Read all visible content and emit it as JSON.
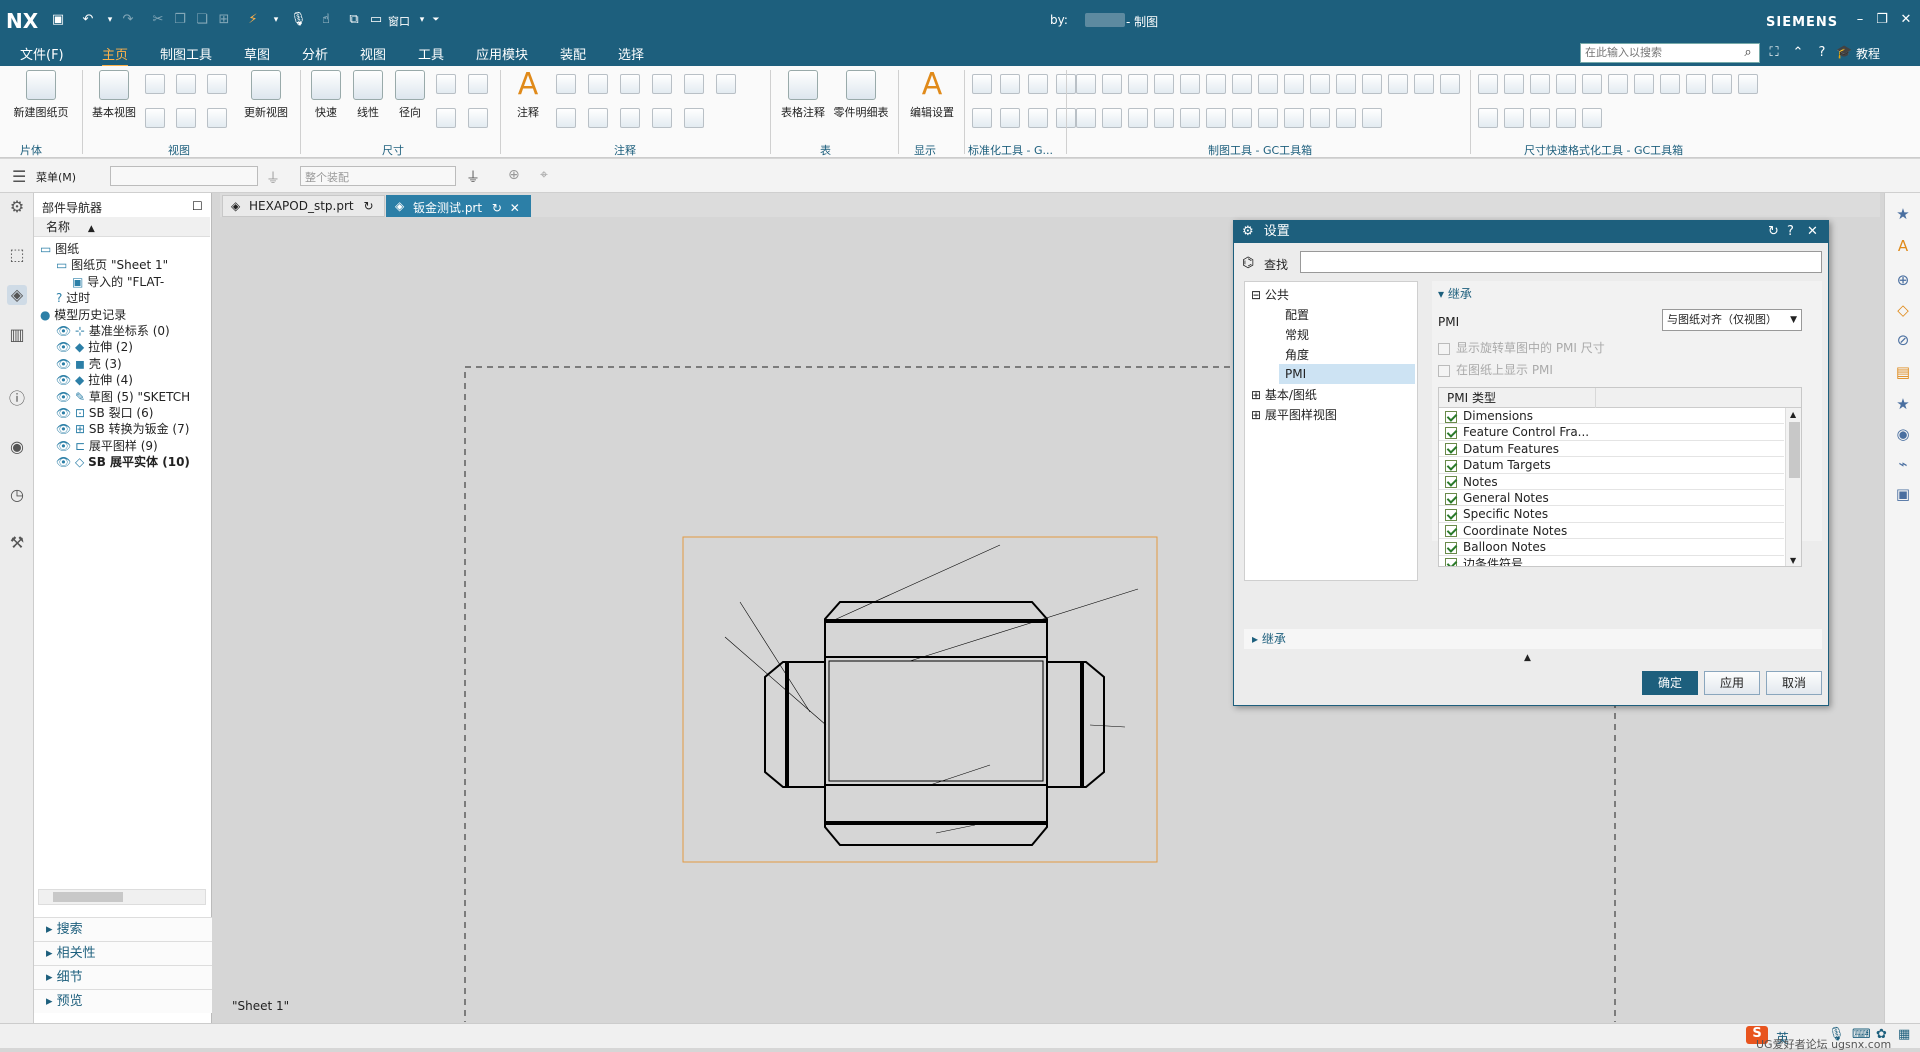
{
  "app": {
    "logo": "NX",
    "title_by": "by:",
    "window_title": "- 制图",
    "brand": "SIEMENS",
    "window_menu": "窗口",
    "help_label": "教程"
  },
  "menu": [
    "文件(F)",
    "主页",
    "制图工具",
    "草图",
    "分析",
    "视图",
    "工具",
    "应用模块",
    "装配",
    "选择"
  ],
  "search": {
    "placeholder": "在此输入以搜索"
  },
  "ribbon": {
    "buttons": {
      "new_sheet": "新建图纸页",
      "base_view": "基本视图",
      "update_view": "更新视图",
      "quick": "快速",
      "linear": "线性",
      "radial": "径向",
      "note": "注释",
      "table_note": "表格注释",
      "parts_list": "零件明细表",
      "edit_settings": "编辑设置"
    },
    "groups": {
      "sheet": "片体",
      "view": "视图",
      "dimension": "尺寸",
      "annotation": "注释",
      "table": "表",
      "display": "显示",
      "std_tools": "标准化工具 - G...",
      "draft_tools": "制图工具 - GC工具箱",
      "dim_format": "尺寸快速格式化工具 - GC工具箱"
    }
  },
  "toolbar2": {
    "menu_label": "菜单(M)",
    "filter_placeholder": "",
    "assembly_combo": "整个装配"
  },
  "nav": {
    "title": "部件导航器",
    "column": "名称",
    "tree": [
      {
        "label": "图纸",
        "indent": 0,
        "icon": "drawing-icon"
      },
      {
        "label": "图纸页 \"Sheet 1\"",
        "indent": 1,
        "icon": "sheet-icon"
      },
      {
        "label": "导入的 \"FLAT-",
        "indent": 2,
        "icon": "view-icon"
      },
      {
        "label": "过时",
        "indent": 1,
        "icon": "outdated-icon"
      },
      {
        "label": "模型历史记录",
        "indent": 0,
        "icon": "history-icon"
      },
      {
        "label": "基准坐标系 (0)",
        "indent": 1,
        "icon": "csys-icon"
      },
      {
        "label": "拉伸 (2)",
        "indent": 1,
        "icon": "extrude-icon"
      },
      {
        "label": "壳 (3)",
        "indent": 1,
        "icon": "shell-icon"
      },
      {
        "label": "拉伸 (4)",
        "indent": 1,
        "icon": "extrude-icon"
      },
      {
        "label": "草图 (5) \"SKETCH",
        "indent": 1,
        "icon": "sketch-icon"
      },
      {
        "label": "SB 裂口 (6)",
        "indent": 1,
        "icon": "rip-icon"
      },
      {
        "label": "SB 转换为钣金 (7)",
        "indent": 1,
        "icon": "convert-icon"
      },
      {
        "label": "展平图样 (9)",
        "indent": 1,
        "icon": "flat-pattern-icon"
      },
      {
        "label": "SB 展平实体 (10)",
        "indent": 1,
        "icon": "flat-solid-icon",
        "bold": true
      }
    ],
    "accordion": [
      "搜索",
      "相关性",
      "细节",
      "预览"
    ]
  },
  "tabs": [
    {
      "label": "HEXAPOD_stp.prt"
    },
    {
      "label": "钣金测试.prt"
    }
  ],
  "canvas": {
    "sheet_label": "\"Sheet 1\""
  },
  "dialog": {
    "title": "设置",
    "find_label": "查找",
    "find_value": "",
    "tree": {
      "common": "公共",
      "items": [
        "配置",
        "常规",
        "角度",
        "PMI"
      ],
      "basic": "基本/图纸",
      "flat": "展平图样视图"
    },
    "section_title": "继承",
    "pmi_label": "PMI",
    "pmi_select": "与图纸对齐（仅视图）",
    "opt_rotate": "显示旋转草图中的 PMI 尺寸",
    "opt_show": "在图纸上显示 PMI",
    "pmi_header": "PMI 类型",
    "pmi_types": [
      "Dimensions",
      "Feature Control Fra...",
      "Datum Features",
      "Datum Targets",
      "Notes",
      "General Notes",
      "Specific Notes",
      "Coordinate Notes",
      "Balloon Notes",
      "边条件符号"
    ],
    "section2": "继承",
    "btn_ok": "确定",
    "btn_apply": "应用",
    "btn_cancel": "取消"
  },
  "taskbar": {
    "ime": "英",
    "watermark": "UG爱好者论坛 ugsnx.com"
  },
  "colors": {
    "brand_bar": "#1d5f7d",
    "active_menu": "#ffb24a",
    "primary_button": "#1d5f7d",
    "frame_orange": "#e39a43"
  }
}
